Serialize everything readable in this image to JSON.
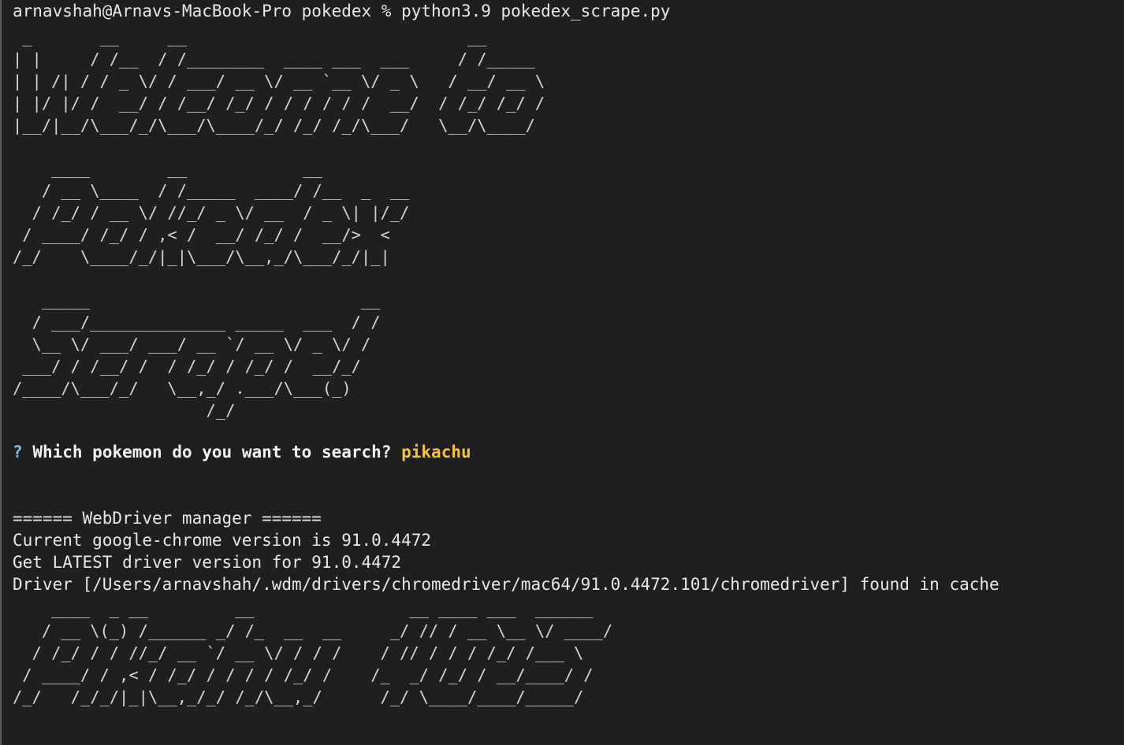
{
  "terminal": {
    "prompt_line": "arnavshah@Arnavs-MacBook-Pro pokedex % python3.9 pokedex_scrape.py",
    "banner_welcome": " _       __     __                             __      \n| |     / /__  / /________  ____ ___  ___     / /_____ \n| | /| / / _ \\/ / ___/ __ \\/ __ `__ \\/ _ \\   / __/ __ \\\n| |/ |/ /  __/ / /__/ /_/ / / / / / /  __/  / /_/ /_/ /\n|__/|__/\\___/_/\\___/\\____/_/ /_/ /_/\\___/   \\__/\\____/ ",
    "banner_pokedex": "    ____        __            __         \n   / __ \\____  / /_____  ____/ /__  _  __\n  / /_/ / __ \\/ //_/ _ \\/ __  / _ \\| |/_/\n / ____/ /_/ / ,< /  __/ /_/ /  __/>  <  \n/_/    \\____/_/|_|\\___/\\__,_/\\___/_/|_|  ",
    "banner_scraper": "   _____                            __\n  / ___/______________ _____  ___  / /\n  \\__ \\/ ___/ ___/ __ `/ __ \\/ _ \\/ / \n ___/ / /__/ /  / /_/ / /_/ /  __/_/  \n/____/\\___/_/   \\__,_/ .___/\\___(_)   \n                    /_/               ",
    "question_mark": "?",
    "question": "Which pokemon do you want to search?",
    "answer": "pikachu",
    "wdm_header": "====== WebDriver manager ======",
    "wdm_line1": "Current google-chrome version is 91.0.4472",
    "wdm_line2": "Get LATEST driver version for 91.0.4472",
    "wdm_line3": "Driver [/Users/arnavshah/.wdm/drivers/chromedriver/mac64/91.0.4472.101/chromedriver] found in cache",
    "banner_result": "    ____  _ __         __                __ ____ ___  ______\n   / __ \\(_) /______ _/ /_  __  __     _/ // / __ \\__ \\/ ____/\n  / /_/ / / //_/ __ `/ __ \\/ / / /    / // / / / /_/ /___ \\ \n / ____/ / ,< / /_/ / / / / /_/ /    /_  _/ /_/ / __/____/ / \n/_/   /_/_/|_|\\__,_/_/ /_/\\__,_/      /_/ \\____/____/_____/  "
  },
  "colors": {
    "background": "#1f1f1f",
    "text": "#e8e8e8",
    "answer": "#f5c242",
    "question_mark": "#8fb8e8"
  }
}
